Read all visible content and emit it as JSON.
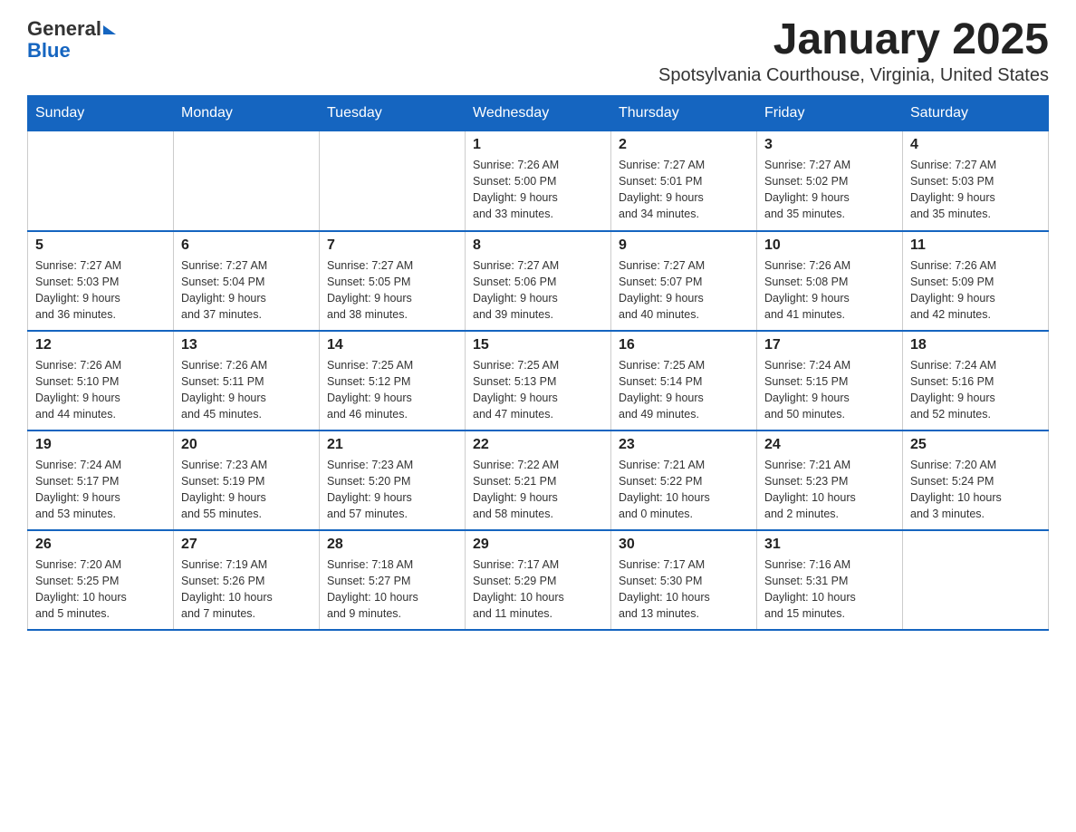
{
  "header": {
    "logo_line1": "General",
    "logo_line2": "Blue",
    "title": "January 2025",
    "subtitle": "Spotsylvania Courthouse, Virginia, United States"
  },
  "days_of_week": [
    "Sunday",
    "Monday",
    "Tuesday",
    "Wednesday",
    "Thursday",
    "Friday",
    "Saturday"
  ],
  "weeks": [
    [
      {
        "num": "",
        "info": ""
      },
      {
        "num": "",
        "info": ""
      },
      {
        "num": "",
        "info": ""
      },
      {
        "num": "1",
        "info": "Sunrise: 7:26 AM\nSunset: 5:00 PM\nDaylight: 9 hours\nand 33 minutes."
      },
      {
        "num": "2",
        "info": "Sunrise: 7:27 AM\nSunset: 5:01 PM\nDaylight: 9 hours\nand 34 minutes."
      },
      {
        "num": "3",
        "info": "Sunrise: 7:27 AM\nSunset: 5:02 PM\nDaylight: 9 hours\nand 35 minutes."
      },
      {
        "num": "4",
        "info": "Sunrise: 7:27 AM\nSunset: 5:03 PM\nDaylight: 9 hours\nand 35 minutes."
      }
    ],
    [
      {
        "num": "5",
        "info": "Sunrise: 7:27 AM\nSunset: 5:03 PM\nDaylight: 9 hours\nand 36 minutes."
      },
      {
        "num": "6",
        "info": "Sunrise: 7:27 AM\nSunset: 5:04 PM\nDaylight: 9 hours\nand 37 minutes."
      },
      {
        "num": "7",
        "info": "Sunrise: 7:27 AM\nSunset: 5:05 PM\nDaylight: 9 hours\nand 38 minutes."
      },
      {
        "num": "8",
        "info": "Sunrise: 7:27 AM\nSunset: 5:06 PM\nDaylight: 9 hours\nand 39 minutes."
      },
      {
        "num": "9",
        "info": "Sunrise: 7:27 AM\nSunset: 5:07 PM\nDaylight: 9 hours\nand 40 minutes."
      },
      {
        "num": "10",
        "info": "Sunrise: 7:26 AM\nSunset: 5:08 PM\nDaylight: 9 hours\nand 41 minutes."
      },
      {
        "num": "11",
        "info": "Sunrise: 7:26 AM\nSunset: 5:09 PM\nDaylight: 9 hours\nand 42 minutes."
      }
    ],
    [
      {
        "num": "12",
        "info": "Sunrise: 7:26 AM\nSunset: 5:10 PM\nDaylight: 9 hours\nand 44 minutes."
      },
      {
        "num": "13",
        "info": "Sunrise: 7:26 AM\nSunset: 5:11 PM\nDaylight: 9 hours\nand 45 minutes."
      },
      {
        "num": "14",
        "info": "Sunrise: 7:25 AM\nSunset: 5:12 PM\nDaylight: 9 hours\nand 46 minutes."
      },
      {
        "num": "15",
        "info": "Sunrise: 7:25 AM\nSunset: 5:13 PM\nDaylight: 9 hours\nand 47 minutes."
      },
      {
        "num": "16",
        "info": "Sunrise: 7:25 AM\nSunset: 5:14 PM\nDaylight: 9 hours\nand 49 minutes."
      },
      {
        "num": "17",
        "info": "Sunrise: 7:24 AM\nSunset: 5:15 PM\nDaylight: 9 hours\nand 50 minutes."
      },
      {
        "num": "18",
        "info": "Sunrise: 7:24 AM\nSunset: 5:16 PM\nDaylight: 9 hours\nand 52 minutes."
      }
    ],
    [
      {
        "num": "19",
        "info": "Sunrise: 7:24 AM\nSunset: 5:17 PM\nDaylight: 9 hours\nand 53 minutes."
      },
      {
        "num": "20",
        "info": "Sunrise: 7:23 AM\nSunset: 5:19 PM\nDaylight: 9 hours\nand 55 minutes."
      },
      {
        "num": "21",
        "info": "Sunrise: 7:23 AM\nSunset: 5:20 PM\nDaylight: 9 hours\nand 57 minutes."
      },
      {
        "num": "22",
        "info": "Sunrise: 7:22 AM\nSunset: 5:21 PM\nDaylight: 9 hours\nand 58 minutes."
      },
      {
        "num": "23",
        "info": "Sunrise: 7:21 AM\nSunset: 5:22 PM\nDaylight: 10 hours\nand 0 minutes."
      },
      {
        "num": "24",
        "info": "Sunrise: 7:21 AM\nSunset: 5:23 PM\nDaylight: 10 hours\nand 2 minutes."
      },
      {
        "num": "25",
        "info": "Sunrise: 7:20 AM\nSunset: 5:24 PM\nDaylight: 10 hours\nand 3 minutes."
      }
    ],
    [
      {
        "num": "26",
        "info": "Sunrise: 7:20 AM\nSunset: 5:25 PM\nDaylight: 10 hours\nand 5 minutes."
      },
      {
        "num": "27",
        "info": "Sunrise: 7:19 AM\nSunset: 5:26 PM\nDaylight: 10 hours\nand 7 minutes."
      },
      {
        "num": "28",
        "info": "Sunrise: 7:18 AM\nSunset: 5:27 PM\nDaylight: 10 hours\nand 9 minutes."
      },
      {
        "num": "29",
        "info": "Sunrise: 7:17 AM\nSunset: 5:29 PM\nDaylight: 10 hours\nand 11 minutes."
      },
      {
        "num": "30",
        "info": "Sunrise: 7:17 AM\nSunset: 5:30 PM\nDaylight: 10 hours\nand 13 minutes."
      },
      {
        "num": "31",
        "info": "Sunrise: 7:16 AM\nSunset: 5:31 PM\nDaylight: 10 hours\nand 15 minutes."
      },
      {
        "num": "",
        "info": ""
      }
    ]
  ]
}
